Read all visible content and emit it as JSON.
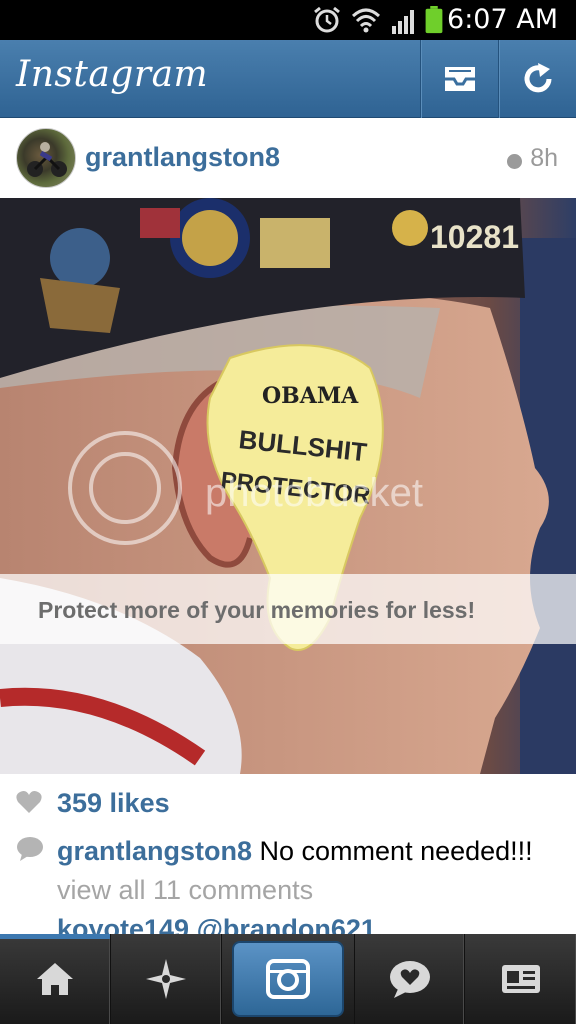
{
  "status_bar": {
    "time": "6:07 AM"
  },
  "header": {
    "title": "Instagram",
    "inbox_icon": "inbox-icon",
    "refresh_icon": "refresh-icon",
    "bg": "#3a6f9f"
  },
  "post": {
    "username": "grantlangston8",
    "time_ago": "8h",
    "image": {
      "sign_brand": "OBAMA",
      "sign_line1": "BULLSHIT",
      "sign_line2": "PROTECTOR",
      "watermark": "photobucket",
      "banner": "Protect more of your memories for less!",
      "hat_number": "10281"
    },
    "likes": "359 likes",
    "caption_user": "grantlangston8",
    "caption_text": " No comment needed!!!",
    "view_all": "view all 11 comments",
    "next_comment": "koyote149 @brandon621"
  },
  "nav": {
    "items": [
      "home-icon",
      "explore-icon",
      "camera-icon",
      "activity-icon",
      "profile-icon"
    ],
    "active": "home-icon"
  }
}
